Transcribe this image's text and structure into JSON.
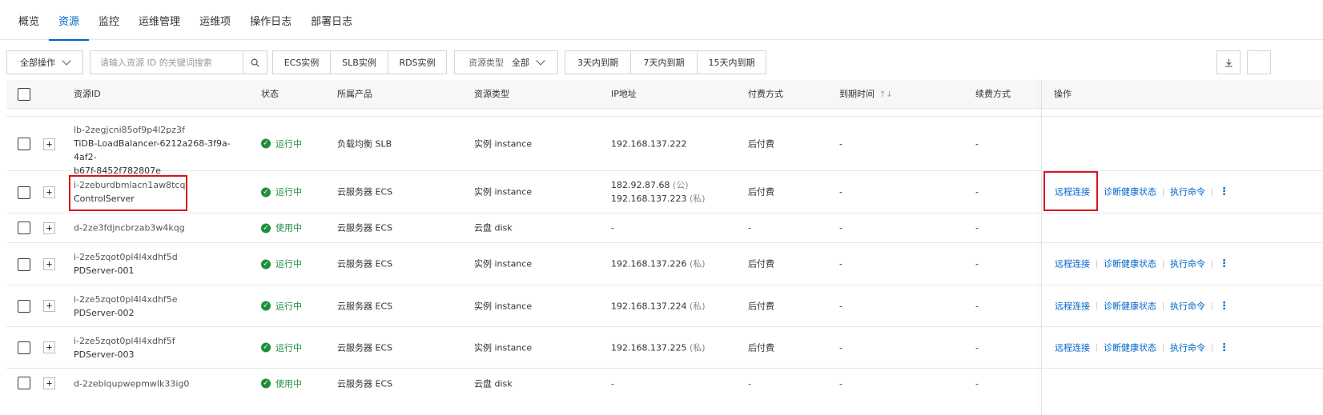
{
  "tabs": [
    "概览",
    "资源",
    "监控",
    "运维管理",
    "运维项",
    "操作日志",
    "部署日志"
  ],
  "toolbar": {
    "all_actions": "全部操作",
    "search_placeholder": "请输入资源 ID 的关键词搜索",
    "type_filters": [
      "ECS实例",
      "SLB实例",
      "RDS实例"
    ],
    "resource_type_label": "资源类型",
    "resource_type_value": "全部",
    "expiry_filters": [
      "3天内到期",
      "7天内到期",
      "15天内到期"
    ]
  },
  "columns": {
    "resource_id": "资源ID",
    "status": "状态",
    "product": "所属产品",
    "type": "资源类型",
    "ip": "IP地址",
    "billing": "付费方式",
    "expire": "到期时间",
    "renew": "续费方式",
    "ops": "操作"
  },
  "ops_labels": {
    "remote": "远程连接",
    "diagnose": "诊断健康状态",
    "exec": "执行命令"
  },
  "rows": [
    {
      "id_line1": "lb-2zegjcni85of9p4l2pz3f",
      "id_line2": "TiDB-LoadBalancer-6212a268-3f9a-4af2-",
      "id_line3": "b67f-8452f782807e",
      "status": "运行中",
      "product": "负载均衡 SLB",
      "type": "实例 instance",
      "ip1": "192.168.137.222",
      "ip1_tag": "",
      "ip2": "",
      "ip2_tag": "",
      "billing": "后付费",
      "expire": "-",
      "renew": "-"
    },
    {
      "id_line1": "i-2zeburdbmlacn1aw8tcq",
      "id_line2": "ControlServer",
      "status": "运行中",
      "product": "云服务器 ECS",
      "type": "实例 instance",
      "ip1": "182.92.87.68",
      "ip1_tag": "(公)",
      "ip2": "192.168.137.223",
      "ip2_tag": "(私)",
      "billing": "后付费",
      "expire": "-",
      "renew": "-"
    },
    {
      "id_line1": "d-2ze3fdjncbrzab3w4kqg",
      "status": "使用中",
      "product": "云服务器 ECS",
      "type": "云盘 disk",
      "ip1": "-",
      "billing": "-",
      "expire": "-",
      "renew": "-"
    },
    {
      "id_line1": "i-2ze5zqot0pl4l4xdhf5d",
      "id_line2": "PDServer-001",
      "status": "运行中",
      "product": "云服务器 ECS",
      "type": "实例 instance",
      "ip1": "192.168.137.226",
      "ip1_tag": "(私)",
      "billing": "后付费",
      "expire": "-",
      "renew": "-"
    },
    {
      "id_line1": "i-2ze5zqot0pl4l4xdhf5e",
      "id_line2": "PDServer-002",
      "status": "运行中",
      "product": "云服务器 ECS",
      "type": "实例 instance",
      "ip1": "192.168.137.224",
      "ip1_tag": "(私)",
      "billing": "后付费",
      "expire": "-",
      "renew": "-"
    },
    {
      "id_line1": "i-2ze5zqot0pl4l4xdhf5f",
      "id_line2": "PDServer-003",
      "status": "运行中",
      "product": "云服务器 ECS",
      "type": "实例 instance",
      "ip1": "192.168.137.225",
      "ip1_tag": "(私)",
      "billing": "后付费",
      "expire": "-",
      "renew": "-"
    },
    {
      "id_line1": "d-2zeblqupwepmwlk33ig0",
      "status": "使用中",
      "product": "云服务器 ECS",
      "type": "云盘 disk",
      "ip1": "-",
      "billing": "-",
      "expire": "-",
      "renew": "-"
    }
  ],
  "colors": {
    "accent": "#0064c8",
    "running": "#1e8e3e",
    "highlight": "#d9141c"
  }
}
